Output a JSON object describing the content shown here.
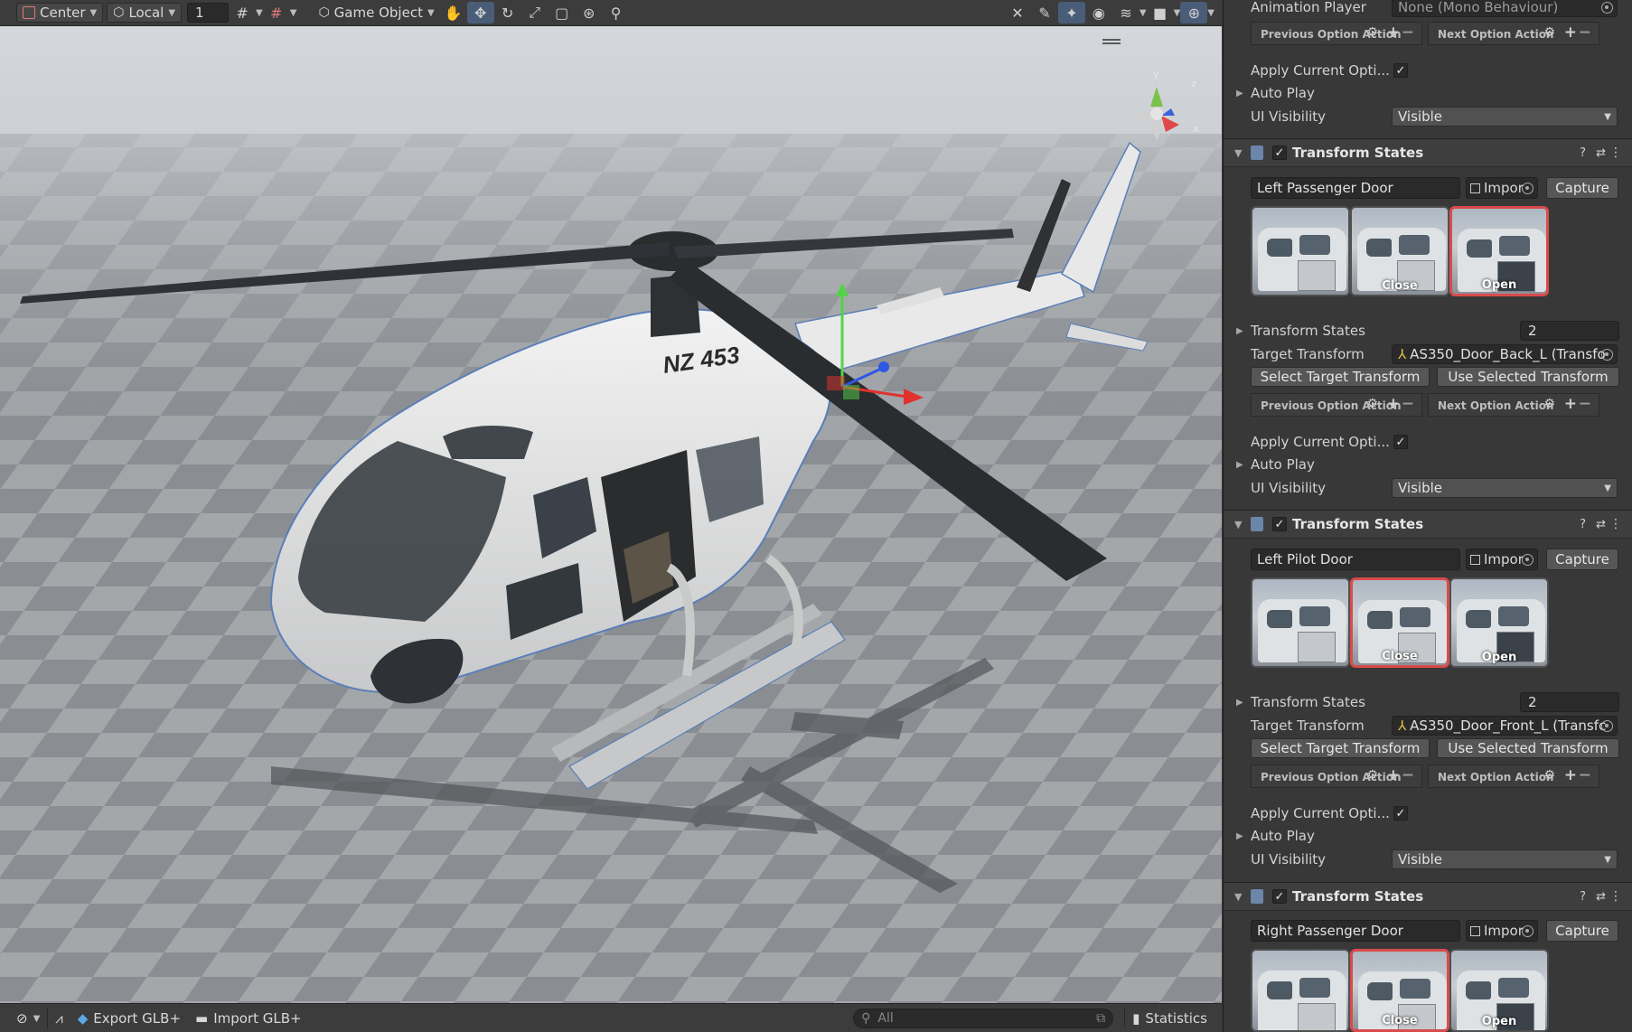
{
  "toolbar": {
    "pivot_mode": "Center",
    "pivot_rotation": "Local",
    "grid_increment": "1",
    "create_menu": "Game Object"
  },
  "bottombar": {
    "export_label": "Export GLB+",
    "import_label": "Import GLB+",
    "search_placeholder": "All",
    "statistics_label": "Statistics"
  },
  "scene": {
    "tail_number": "NZ 453",
    "gizmo_y": "y",
    "gizmo_z": "z",
    "gizmo_x": "x"
  },
  "inspector": {
    "top": {
      "animation_player_label": "Animation Player",
      "animation_player_value": "None (Mono Behaviour)",
      "prev_option": "Previous Option Action",
      "next_option": "Next Option Action",
      "apply_label": "Apply Current Opti...",
      "auto_play_label": "Auto Play",
      "ui_visibility_label": "UI Visibility",
      "ui_visibility_value": "Visible"
    },
    "components": [
      {
        "title": "Transform States",
        "name": "Left Passenger Door",
        "import_label": "Impor",
        "capture_label": "Capture",
        "thumbs": [
          {
            "caption": ""
          },
          {
            "caption": "Close"
          },
          {
            "caption": "Open"
          }
        ],
        "states_label": "Transform States",
        "states_count": "2",
        "target_label": "Target Transform",
        "target_value": "AS350_Door_Back_L (Transfo",
        "select_btn": "Select Target Transform",
        "use_btn": "Use Selected Transform",
        "prev_option": "Previous Option Action",
        "next_option": "Next Option Action",
        "apply_label": "Apply Current Opti...",
        "auto_play_label": "Auto Play",
        "ui_visibility_label": "UI Visibility",
        "ui_visibility_value": "Visible"
      },
      {
        "title": "Transform States",
        "name": "Left Pilot Door",
        "import_label": "Impor",
        "capture_label": "Capture",
        "thumbs": [
          {
            "caption": ""
          },
          {
            "caption": "Close"
          },
          {
            "caption": "Open"
          }
        ],
        "states_label": "Transform States",
        "states_count": "2",
        "target_label": "Target Transform",
        "target_value": "AS350_Door_Front_L (Transfc",
        "select_btn": "Select Target Transform",
        "use_btn": "Use Selected Transform",
        "prev_option": "Previous Option Action",
        "next_option": "Next Option Action",
        "apply_label": "Apply Current Opti...",
        "auto_play_label": "Auto Play",
        "ui_visibility_label": "UI Visibility",
        "ui_visibility_value": "Visible"
      },
      {
        "title": "Transform States",
        "name": "Right Passenger Door",
        "import_label": "Impor",
        "capture_label": "Capture",
        "thumbs": [
          {
            "caption": ""
          },
          {
            "caption": "Close"
          },
          {
            "caption": "Open"
          }
        ]
      }
    ]
  }
}
